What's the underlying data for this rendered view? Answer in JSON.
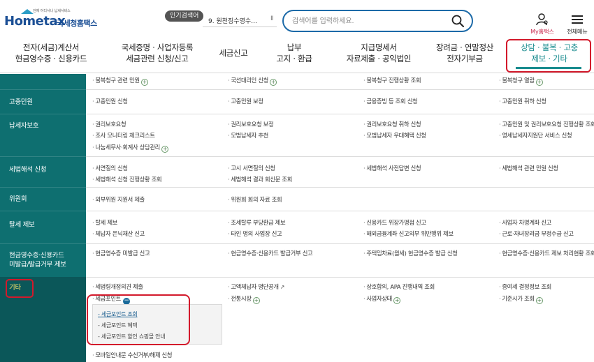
{
  "header": {
    "logo_word": "Hometax",
    "logo_tagline": "언제 어디서나 납세서비스",
    "logo_korean": "국세청홈택스",
    "popular_search_label": "인기검색어",
    "popular_search_item": "9. 원천징수영수…",
    "popular_pause": "II",
    "search_placeholder": "검색어를 입력하세요.",
    "my_hometax_label": "My홈택스",
    "all_menu_label": "전체메뉴"
  },
  "nav": [
    {
      "line1": "전자(세금)계산서",
      "line2": "현금영수증 · 신용카드"
    },
    {
      "line1": "국세증명 · 사업자등록",
      "line2": "세금관련 신청/신고"
    },
    {
      "line1": "세금신고",
      "line2": ""
    },
    {
      "line1": "납부",
      "line2": "고지 · 환급"
    },
    {
      "line1": "지급명세서",
      "line2": "자료제출 · 공익법인"
    },
    {
      "line1": "장려금 · 연말정산",
      "line2": "전자기부금"
    },
    {
      "line1": "상담 · 불복 · 고충",
      "line2": "제보 · 기타"
    }
  ],
  "categories": [
    {
      "label": "고충민원"
    },
    {
      "label": "납세자보호"
    },
    {
      "label": "세법해석 신청"
    },
    {
      "label": "위원회"
    },
    {
      "label": "탈세 제보"
    },
    {
      "line1": "현금영수증·신용카드",
      "line2": "미발급/발급거부 제보"
    },
    {
      "label": "기타"
    }
  ],
  "rows": {
    "r0": [
      "불복청구 관련 민원",
      "국선대리인 신청",
      "불복청구 진행상황 조회",
      "불복청구 열람"
    ],
    "r1": [
      "고충민원 신청",
      "고충민원 보정",
      "금융증빙 등 조회 신청",
      "고충민원 취하 신청"
    ],
    "r2": [
      "권리보호요청",
      "권리보호요청 보정",
      "권리보호요청 취하 신청",
      "고충민원 및 권리보호요청 진행상황 조회",
      "조사 모니터링 체크리스트",
      "모범납세자 추천",
      "모범납세자 우대혜택 신청",
      "영세납세자지원단 서비스 신청",
      "나눔세무사·회계사 상담관리"
    ],
    "r3": [
      "서면질의 신청",
      "고시 서면질의 신청",
      "세법해석 사전답변 신청",
      "세법해석 관련 민원 신청",
      "세법해석 신청 진행상황 조회",
      "세법해석 결과 회신문 조회"
    ],
    "r4": [
      "외부위원 지원서 제출",
      "위원회 회의 자료 조회"
    ],
    "r5": [
      "탈세 제보",
      "조세탈루 부당환급 제보",
      "신용카드 위장가맹점 신고",
      "사업자 차명계좌 신고",
      "체납자 은닉재산 신고",
      "타인 명의 사업장 신고",
      "해외금융계좌 신고의무 위반행위 제보",
      "근로·자녀장려금 부정수급 신고"
    ],
    "r6": [
      "현금영수증 미발급 신고",
      "현금영수증·신용카드 발급거부 신고",
      "주택임차료(월세) 현금영수증 발급 신청",
      "현금영수증·신용카드 제보 처리현황 조회"
    ],
    "r7": [
      "세법령개정의견 제출",
      "고액체납자 명단공개",
      "상호합의, APA 진행내역 조회",
      "증여세 결정정보 조회",
      "세금포인트",
      "전통시장",
      "사업자상태",
      "기준시가 조회",
      "모바일안내문 수신거부/해제 신청"
    ]
  },
  "submenu": [
    "- 세금포인트 조회",
    "- 세금포인트 혜택",
    "- 세금포인트 할인 쇼핑몰 안내"
  ],
  "colors": {
    "sidebar": "#0e6f70",
    "accent_teal": "#1a8c8f",
    "highlight_red": "#d3192b",
    "brand_blue": "#1b4f95"
  }
}
